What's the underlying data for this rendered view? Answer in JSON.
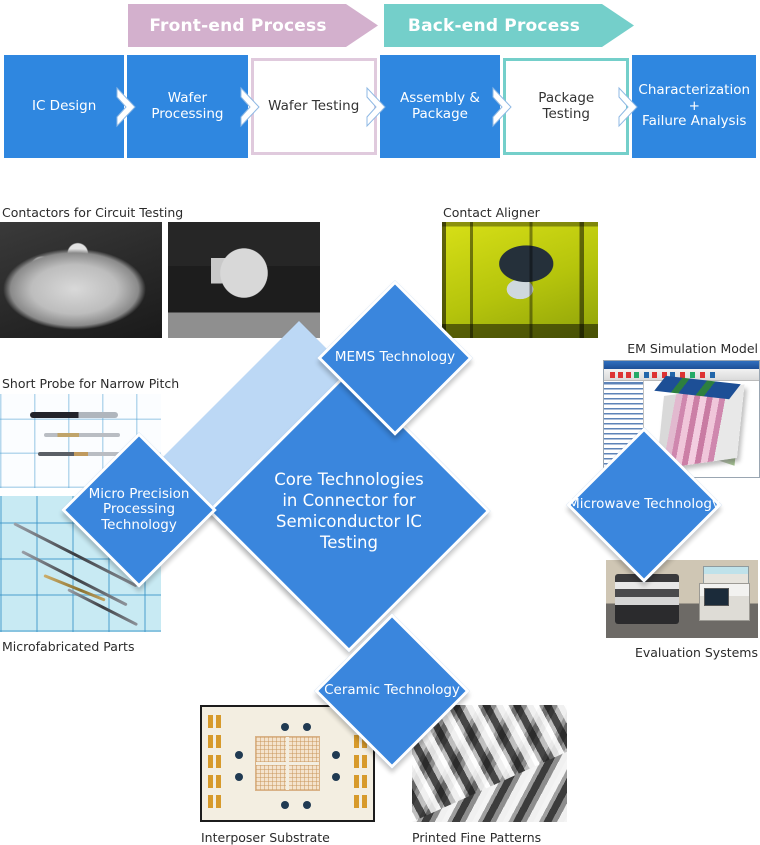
{
  "banners": [
    {
      "label": "Front-end Process",
      "color": "#d3b0cd"
    },
    {
      "label": "Back-end Process",
      "color": "#74cfca"
    }
  ],
  "process_flow": {
    "steps": [
      {
        "label": "IC Design",
        "style": "blue"
      },
      {
        "label": "Wafer\nProcessing",
        "style": "blue"
      },
      {
        "label": "Wafer Testing",
        "style": "highlight-pink"
      },
      {
        "label": "Assembly &\nPackage",
        "style": "blue"
      },
      {
        "label": "Package\nTesting",
        "style": "highlight-teal"
      },
      {
        "label": "Characterization\n+\nFailure Analysis",
        "style": "blue"
      }
    ],
    "box_color": "#2f87e0",
    "highlight_pink_border": "#e0cadd",
    "highlight_teal_border": "#74cfca",
    "arrow_icon": "chevron-right-icon"
  },
  "diagram": {
    "core": {
      "label": "Core Technologies\nin Connector for\nSemiconductor IC\nTesting",
      "color": "#3a86dd",
      "backdrop_color": "#bcd8f5"
    },
    "nodes": [
      {
        "id": "mems",
        "label": "MEMS Technology",
        "color": "#3a86dd"
      },
      {
        "id": "micro",
        "label": "Micro Precision\nProcessing\nTechnology",
        "color": "#3a86dd"
      },
      {
        "id": "microwave",
        "label": "Microwave Technology",
        "color": "#3a86dd"
      },
      {
        "id": "ceramic",
        "label": "Ceramic Technology",
        "color": "#3a86dd"
      }
    ],
    "photos": [
      {
        "id": "contactors-a",
        "caption": "Contactors for Circuit Testing",
        "caption_align": "left"
      },
      {
        "id": "contactors-b",
        "caption": "",
        "caption_align": "left"
      },
      {
        "id": "contact-aligner",
        "caption": "Contact Aligner",
        "caption_align": "left"
      },
      {
        "id": "short-probe",
        "caption": "Short Probe for Narrow Pitch",
        "caption_align": "left"
      },
      {
        "id": "microfab",
        "caption": "Microfabricated Parts",
        "caption_align": "left"
      },
      {
        "id": "em-sim",
        "caption": "EM Simulation Model",
        "caption_align": "right"
      },
      {
        "id": "eval-systems",
        "caption": "Evaluation Systems",
        "caption_align": "right"
      },
      {
        "id": "interposer",
        "caption": "Interposer Substrate",
        "caption_align": "left"
      },
      {
        "id": "fine-patterns",
        "caption": "Printed Fine Patterns",
        "caption_align": "left"
      }
    ]
  }
}
